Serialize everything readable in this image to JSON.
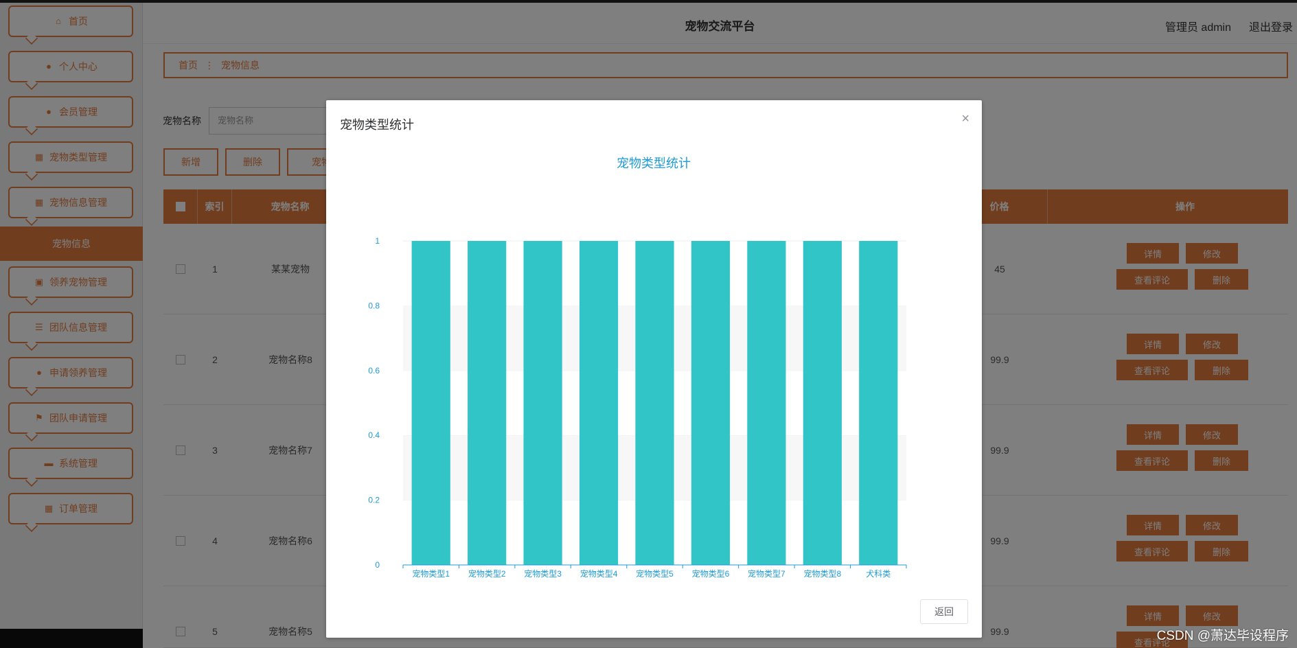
{
  "app": {
    "title": "宠物交流平台",
    "user": "管理员 admin",
    "logout": "退出登录"
  },
  "sidebar": {
    "items": [
      {
        "label": "首页",
        "icon": "home-icon"
      },
      {
        "label": "个人中心",
        "icon": "user-icon"
      },
      {
        "label": "会员管理",
        "icon": "user-icon"
      },
      {
        "label": "宠物类型管理",
        "icon": "grid-icon"
      },
      {
        "label": "宠物信息管理",
        "icon": "grid-icon"
      },
      {
        "label": "领养宠物管理",
        "icon": "clipboard-icon"
      },
      {
        "label": "团队信息管理",
        "icon": "list-icon"
      },
      {
        "label": "申请领养管理",
        "icon": "user-icon"
      },
      {
        "label": "团队申请管理",
        "icon": "flag-icon"
      },
      {
        "label": "系统管理",
        "icon": "monitor-icon"
      },
      {
        "label": "订单管理",
        "icon": "grid-icon"
      }
    ],
    "active_sub": "宠物信息"
  },
  "breadcrumb": {
    "home": "首页",
    "current": "宠物信息"
  },
  "search": {
    "label": "宠物名称",
    "placeholder": "宠物名称"
  },
  "actions": {
    "add": "新增",
    "delete": "删除",
    "stat": "宠物"
  },
  "table": {
    "headers": {
      "index": "索引",
      "name": "宠物名称",
      "price": "价格",
      "ops": "操作"
    },
    "rows": [
      {
        "index": "1",
        "name": "某某宠物",
        "price": "45"
      },
      {
        "index": "2",
        "name": "宠物名称8",
        "price": "99.9"
      },
      {
        "index": "3",
        "name": "宠物名称7",
        "price": "99.9"
      },
      {
        "index": "4",
        "name": "宠物名称6",
        "price": "99.9"
      },
      {
        "index": "5",
        "name": "宠物名称5",
        "price": "99.9"
      }
    ],
    "row_buttons": {
      "detail": "详情",
      "edit": "修改",
      "comments": "查看评论",
      "delete": "删除"
    }
  },
  "dialog": {
    "title": "宠物类型统计",
    "back": "返回",
    "close": "×"
  },
  "chart_data": {
    "type": "bar",
    "title": "宠物类型统计",
    "categories": [
      "宠物类型1",
      "宠物类型2",
      "宠物类型3",
      "宠物类型4",
      "宠物类型5",
      "宠物类型6",
      "宠物类型7",
      "宠物类型8",
      "犬科类"
    ],
    "values": [
      1,
      1,
      1,
      1,
      1,
      1,
      1,
      1,
      1
    ],
    "ylim": [
      0,
      1
    ],
    "yticks": [
      "0",
      "0.2",
      "0.4",
      "0.6",
      "0.8",
      "1"
    ],
    "bar_color": "#32c5c8",
    "axis_color": "#1e9bd7",
    "title_color": "#1e9bd7",
    "grid": "horizontal bands"
  },
  "watermark": "CSDN @萧达毕设程序",
  "colors": {
    "accent": "#e27a3f"
  }
}
